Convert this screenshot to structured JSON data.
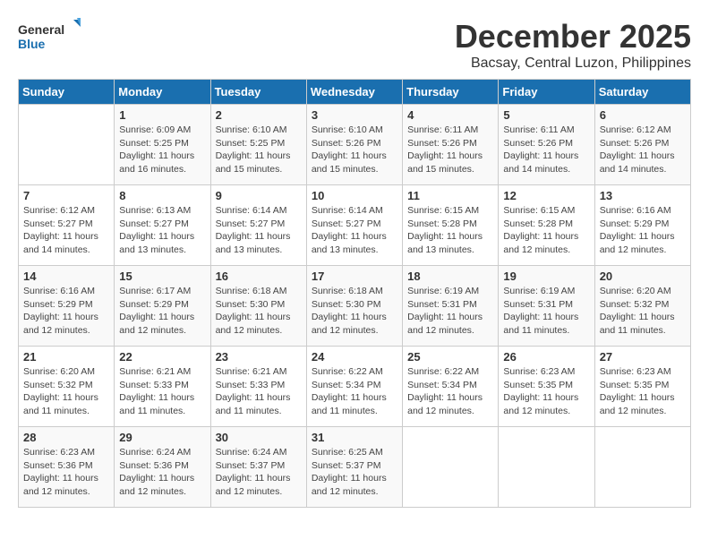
{
  "logo": {
    "line1": "General",
    "line2": "Blue"
  },
  "title": "December 2025",
  "subtitle": "Bacsay, Central Luzon, Philippines",
  "days_header": [
    "Sunday",
    "Monday",
    "Tuesday",
    "Wednesday",
    "Thursday",
    "Friday",
    "Saturday"
  ],
  "weeks": [
    [
      {
        "day": "",
        "info": ""
      },
      {
        "day": "1",
        "info": "Sunrise: 6:09 AM\nSunset: 5:25 PM\nDaylight: 11 hours\nand 16 minutes."
      },
      {
        "day": "2",
        "info": "Sunrise: 6:10 AM\nSunset: 5:25 PM\nDaylight: 11 hours\nand 15 minutes."
      },
      {
        "day": "3",
        "info": "Sunrise: 6:10 AM\nSunset: 5:26 PM\nDaylight: 11 hours\nand 15 minutes."
      },
      {
        "day": "4",
        "info": "Sunrise: 6:11 AM\nSunset: 5:26 PM\nDaylight: 11 hours\nand 15 minutes."
      },
      {
        "day": "5",
        "info": "Sunrise: 6:11 AM\nSunset: 5:26 PM\nDaylight: 11 hours\nand 14 minutes."
      },
      {
        "day": "6",
        "info": "Sunrise: 6:12 AM\nSunset: 5:26 PM\nDaylight: 11 hours\nand 14 minutes."
      }
    ],
    [
      {
        "day": "7",
        "info": "Sunrise: 6:12 AM\nSunset: 5:27 PM\nDaylight: 11 hours\nand 14 minutes."
      },
      {
        "day": "8",
        "info": "Sunrise: 6:13 AM\nSunset: 5:27 PM\nDaylight: 11 hours\nand 13 minutes."
      },
      {
        "day": "9",
        "info": "Sunrise: 6:14 AM\nSunset: 5:27 PM\nDaylight: 11 hours\nand 13 minutes."
      },
      {
        "day": "10",
        "info": "Sunrise: 6:14 AM\nSunset: 5:27 PM\nDaylight: 11 hours\nand 13 minutes."
      },
      {
        "day": "11",
        "info": "Sunrise: 6:15 AM\nSunset: 5:28 PM\nDaylight: 11 hours\nand 13 minutes."
      },
      {
        "day": "12",
        "info": "Sunrise: 6:15 AM\nSunset: 5:28 PM\nDaylight: 11 hours\nand 12 minutes."
      },
      {
        "day": "13",
        "info": "Sunrise: 6:16 AM\nSunset: 5:29 PM\nDaylight: 11 hours\nand 12 minutes."
      }
    ],
    [
      {
        "day": "14",
        "info": "Sunrise: 6:16 AM\nSunset: 5:29 PM\nDaylight: 11 hours\nand 12 minutes."
      },
      {
        "day": "15",
        "info": "Sunrise: 6:17 AM\nSunset: 5:29 PM\nDaylight: 11 hours\nand 12 minutes."
      },
      {
        "day": "16",
        "info": "Sunrise: 6:18 AM\nSunset: 5:30 PM\nDaylight: 11 hours\nand 12 minutes."
      },
      {
        "day": "17",
        "info": "Sunrise: 6:18 AM\nSunset: 5:30 PM\nDaylight: 11 hours\nand 12 minutes."
      },
      {
        "day": "18",
        "info": "Sunrise: 6:19 AM\nSunset: 5:31 PM\nDaylight: 11 hours\nand 12 minutes."
      },
      {
        "day": "19",
        "info": "Sunrise: 6:19 AM\nSunset: 5:31 PM\nDaylight: 11 hours\nand 11 minutes."
      },
      {
        "day": "20",
        "info": "Sunrise: 6:20 AM\nSunset: 5:32 PM\nDaylight: 11 hours\nand 11 minutes."
      }
    ],
    [
      {
        "day": "21",
        "info": "Sunrise: 6:20 AM\nSunset: 5:32 PM\nDaylight: 11 hours\nand 11 minutes."
      },
      {
        "day": "22",
        "info": "Sunrise: 6:21 AM\nSunset: 5:33 PM\nDaylight: 11 hours\nand 11 minutes."
      },
      {
        "day": "23",
        "info": "Sunrise: 6:21 AM\nSunset: 5:33 PM\nDaylight: 11 hours\nand 11 minutes."
      },
      {
        "day": "24",
        "info": "Sunrise: 6:22 AM\nSunset: 5:34 PM\nDaylight: 11 hours\nand 11 minutes."
      },
      {
        "day": "25",
        "info": "Sunrise: 6:22 AM\nSunset: 5:34 PM\nDaylight: 11 hours\nand 12 minutes."
      },
      {
        "day": "26",
        "info": "Sunrise: 6:23 AM\nSunset: 5:35 PM\nDaylight: 11 hours\nand 12 minutes."
      },
      {
        "day": "27",
        "info": "Sunrise: 6:23 AM\nSunset: 5:35 PM\nDaylight: 11 hours\nand 12 minutes."
      }
    ],
    [
      {
        "day": "28",
        "info": "Sunrise: 6:23 AM\nSunset: 5:36 PM\nDaylight: 11 hours\nand 12 minutes."
      },
      {
        "day": "29",
        "info": "Sunrise: 6:24 AM\nSunset: 5:36 PM\nDaylight: 11 hours\nand 12 minutes."
      },
      {
        "day": "30",
        "info": "Sunrise: 6:24 AM\nSunset: 5:37 PM\nDaylight: 11 hours\nand 12 minutes."
      },
      {
        "day": "31",
        "info": "Sunrise: 6:25 AM\nSunset: 5:37 PM\nDaylight: 11 hours\nand 12 minutes."
      },
      {
        "day": "",
        "info": ""
      },
      {
        "day": "",
        "info": ""
      },
      {
        "day": "",
        "info": ""
      }
    ]
  ]
}
